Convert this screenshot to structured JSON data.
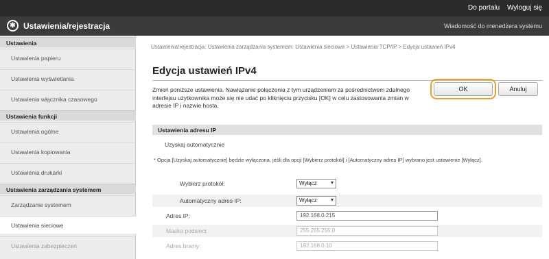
{
  "topbar": {
    "device_name": "",
    "portal_link": "Do portalu",
    "logout_link": "Wyloguj się"
  },
  "header": {
    "logo_icon": "gear-icon",
    "title": "Ustawienia/rejestracja",
    "message_link": "Wiadomość do menedżera systemu"
  },
  "sidebar": {
    "sections": [
      {
        "heading": "Ustawienia",
        "items": [
          "Ustawienia papieru",
          "Ustawienia wyświetlania",
          "Ustawienia włącznika czasowego"
        ]
      },
      {
        "heading": "Ustawienia funkcji",
        "items": [
          "Ustawienia ogólne",
          "Ustawienia kopiowania",
          "Ustawienia drukarki"
        ]
      },
      {
        "heading": "Ustawienia zarządzania systemem",
        "items": [
          "Zarządzanie systemem",
          "Ustawienia sieciowe",
          "Ustawienia zabezpieczeń"
        ]
      }
    ],
    "active_item": "Ustawienia sieciowe"
  },
  "main": {
    "breadcrumb": "Ustawienia/rejestracja: Ustawienia zarządzania systemem: Ustawienia sieciowe > Ustawienia TCP/IP > Edycja ustawień IPv4",
    "title": "Edycja ustawień IPv4",
    "description": "Zmień poniższe ustawienia. Nawiązanie połączenia z tym urządzeniem za pośrednictwem zdalnego interfejsu użytkownika może się nie udać po kliknięciu przycisku [OK] w celu zastosowania zmian w adresie IP i nazwie hosta.",
    "ok_label": "OK",
    "cancel_label": "Anuluj",
    "section_title": "Ustawienia adresu IP",
    "auto_label": "Uzyskaj automatycznie",
    "note": "* Opcja [Uzyskaj automatycznie] będzie wyłączona, jeśli dla opcji [Wybierz protokół] i [Automatyczny adres IP] wybrano jest ustawienie [Wyłącz].",
    "protocol_label": "Wybierz protokół:",
    "protocol_value": "Wyłącz",
    "autoip_label": "Automatyczny adres IP:",
    "autoip_value": "Wyłącz",
    "ip_label": "Adres IP:",
    "ip_value": "192.168.0.215",
    "mask_label": "Maska podsieci:",
    "mask_value": "255.255.255.0",
    "gateway_label": "Adres bramy:",
    "gateway_value": "192.168.0.10"
  },
  "colors": {
    "highlight_ring": "#f0a020",
    "topbar": "#2b2b2b",
    "titlebar": "#3b3b3b"
  }
}
